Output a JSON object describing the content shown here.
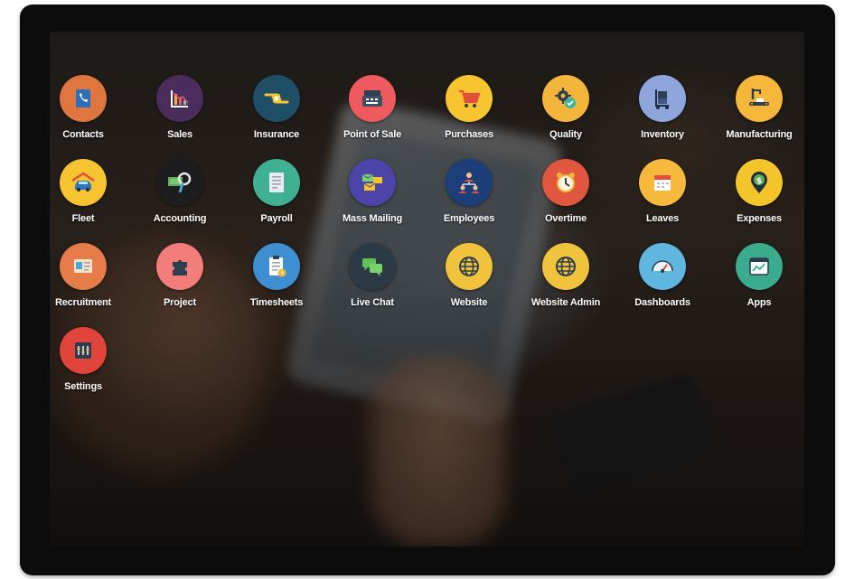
{
  "apps": [
    {
      "label": "Contacts",
      "icon": "contacts-icon",
      "color": "#e0763f"
    },
    {
      "label": "Sales",
      "icon": "sales-chart-icon",
      "color": "#4a2d5c"
    },
    {
      "label": "Insurance",
      "icon": "insurance-hands-icon",
      "color": "#1e4f67"
    },
    {
      "label": "Point of Sale",
      "icon": "cash-register-icon",
      "color": "#ee5b5e"
    },
    {
      "label": "Purchases",
      "icon": "shopping-cart-icon",
      "color": "#f7c530"
    },
    {
      "label": "Quality",
      "icon": "quality-gear-icon",
      "color": "#f3b63a"
    },
    {
      "label": "Inventory",
      "icon": "inventory-cart-icon",
      "color": "#8fa6dd"
    },
    {
      "label": "Manufacturing",
      "icon": "manufacturing-icon",
      "color": "#f5b73a"
    },
    {
      "label": "Fleet",
      "icon": "fleet-car-icon",
      "color": "#f6c431"
    },
    {
      "label": "Accounting",
      "icon": "accounting-icon",
      "color": "#1d1d1f"
    },
    {
      "label": "Payroll",
      "icon": "payroll-document-icon",
      "color": "#3fb091"
    },
    {
      "label": "Mass Mailing",
      "icon": "mass-mailing-icon",
      "color": "#4c44a8"
    },
    {
      "label": "Employees",
      "icon": "employees-icon",
      "color": "#1c3f7a"
    },
    {
      "label": "Overtime",
      "icon": "overtime-clock-icon",
      "color": "#e0563f"
    },
    {
      "label": "Leaves",
      "icon": "leaves-calendar-icon",
      "color": "#f6b93b"
    },
    {
      "label": "Expenses",
      "icon": "expenses-pin-icon",
      "color": "#f3c52b"
    },
    {
      "label": "Recruitment",
      "icon": "recruitment-icon",
      "color": "#e57c4a"
    },
    {
      "label": "Project",
      "icon": "project-puzzle-icon",
      "color": "#f27d7b"
    },
    {
      "label": "Timesheets",
      "icon": "timesheets-icon",
      "color": "#3d8fd1"
    },
    {
      "label": "Live Chat",
      "icon": "live-chat-icon",
      "color": "#2c3a45"
    },
    {
      "label": "Website",
      "icon": "website-globe-icon",
      "color": "#f1c23c"
    },
    {
      "label": "Website Admin",
      "icon": "website-admin-globe-icon",
      "color": "#f1c23c"
    },
    {
      "label": "Dashboards",
      "icon": "dashboards-gauge-icon",
      "color": "#5fb6de"
    },
    {
      "label": "Apps",
      "icon": "apps-window-icon",
      "color": "#3bab8d"
    },
    {
      "label": "Settings",
      "icon": "settings-icon",
      "color": "#e0443b"
    }
  ]
}
